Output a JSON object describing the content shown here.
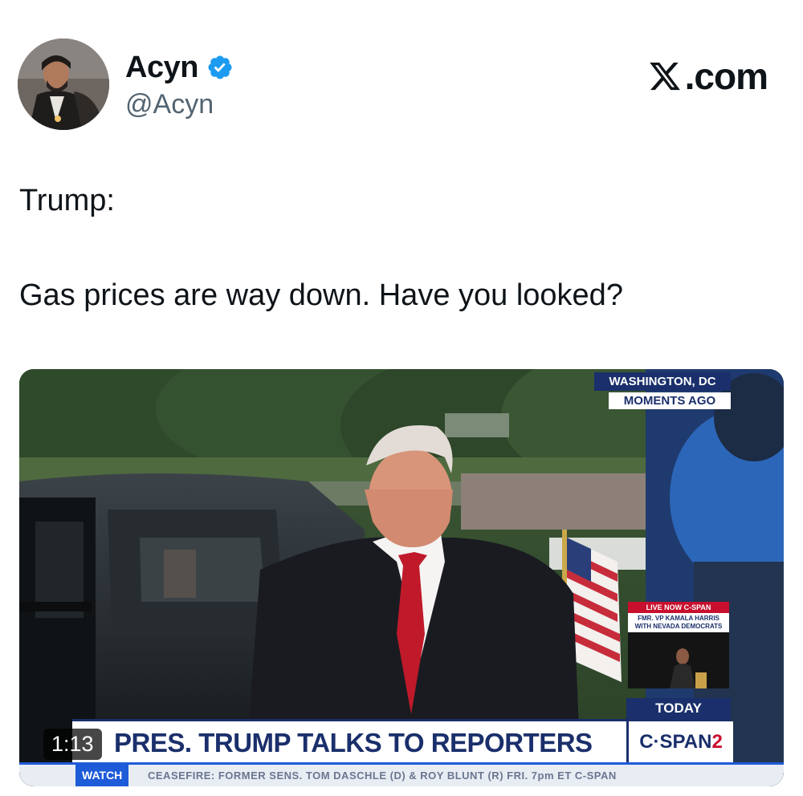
{
  "author": {
    "display_name": "Acyn",
    "handle": "@Acyn",
    "verified": true,
    "verified_color": "#1d9bf0"
  },
  "brand": {
    "logo_icon": "x-logo-icon",
    "domain_text": ".com"
  },
  "tweet": {
    "lines": [
      "Trump:",
      "Gas prices are way down. Have you looked?"
    ]
  },
  "video": {
    "duration": "1:13",
    "overlay": {
      "location": "WASHINGTON, DC",
      "timing": "MOMENTS AGO",
      "live_title": "LIVE NOW C-SPAN",
      "live_subtitle_1": "FMR. VP KAMALA HARRIS",
      "live_subtitle_2": "WITH NEVADA DEMOCRATS",
      "today": "TODAY",
      "network_prefix": "C·SPAN",
      "network_suffix": "2",
      "headline": "PRES. TRUMP TALKS TO REPORTERS",
      "ticker_label": "WATCH",
      "ticker_text": "CEASEFIRE: FORMER SENS. TOM DASCHLE (D) & ROY BLUNT (R)  FRI. 7pm ET  C-SPAN"
    },
    "colors": {
      "cspan_navy": "#1a2f6b",
      "cspan_red": "#c8102e",
      "ticker_blue": "#1e5bd8"
    }
  }
}
